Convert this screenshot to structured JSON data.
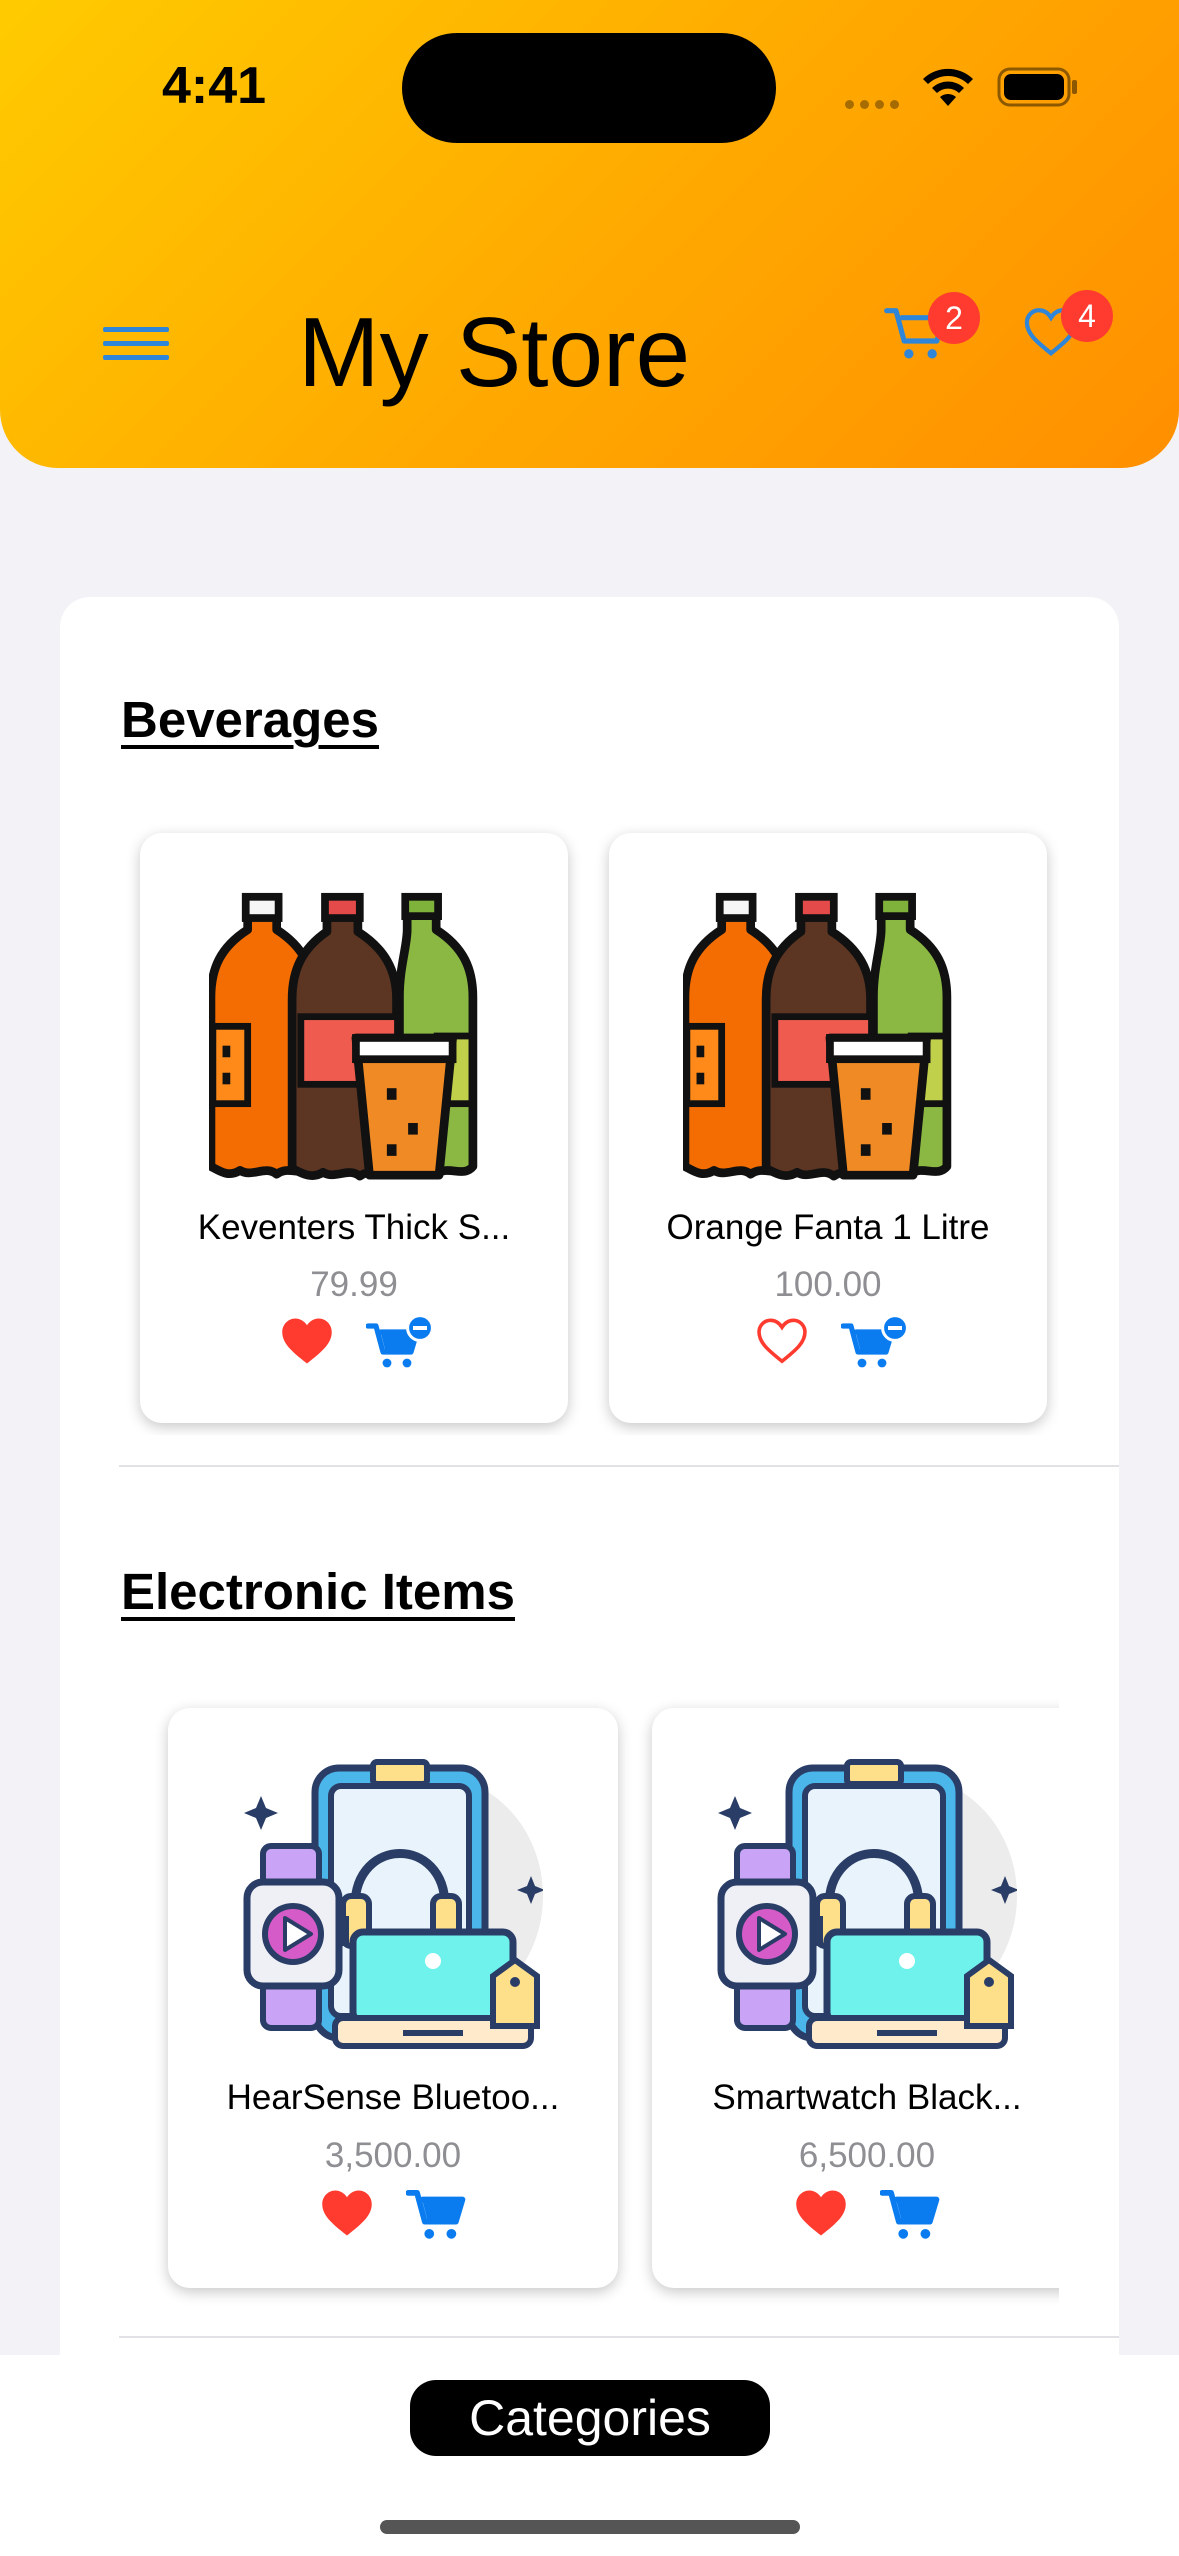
{
  "status_bar": {
    "time": "4:41"
  },
  "header": {
    "title": "My Store",
    "cart_count": "2",
    "favorites_count": "4",
    "icons": [
      "menu-icon",
      "cart-icon",
      "heart-icon"
    ]
  },
  "sections": [
    {
      "title": "Beverages",
      "products": [
        {
          "name": "Keventers Thick S...",
          "price": "79.99",
          "favorited": true,
          "in_cart": true
        },
        {
          "name": "Orange Fanta 1 Litre",
          "price": "100.00",
          "favorited": false,
          "in_cart": true
        }
      ]
    },
    {
      "title": "Electronic Items",
      "products": [
        {
          "name": "HearSense Bluetoo...",
          "price": "3,500.00",
          "favorited": true,
          "in_cart": false
        },
        {
          "name": "Smartwatch Black...",
          "price": "6,500.00",
          "favorited": true,
          "in_cart": false
        }
      ]
    }
  ],
  "bottom": {
    "categories_label": "Categories"
  },
  "colors": {
    "header_gradient_start": "#ffcb00",
    "header_gradient_end": "#ff8f00",
    "accent_blue": "#0a7cf0",
    "heart_red": "#ff3b30",
    "badge_red": "#ff3b30"
  }
}
